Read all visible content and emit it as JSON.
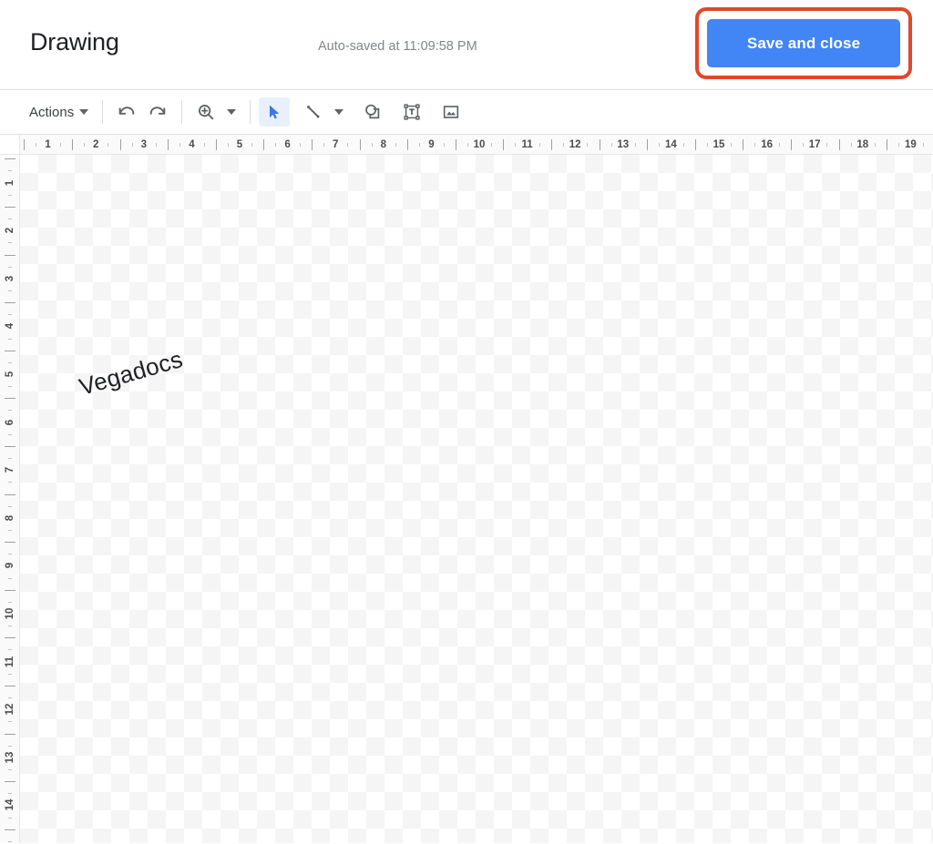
{
  "header": {
    "title": "Drawing",
    "autosave_status": "Auto-saved at 11:09:58 PM",
    "save_button_label": "Save and close",
    "accent_color": "#4285f4",
    "annotation_color": "#e0472c"
  },
  "toolbar": {
    "actions_label": "Actions",
    "items": [
      {
        "name": "actions-menu",
        "label": "Actions",
        "icon": "caret-down-icon"
      },
      {
        "name": "undo-button",
        "label": "Undo",
        "icon": "undo-icon"
      },
      {
        "name": "redo-button",
        "label": "Redo",
        "icon": "redo-icon"
      },
      {
        "name": "zoom-tool",
        "label": "Zoom",
        "icon": "zoom-in-icon"
      },
      {
        "name": "select-tool",
        "label": "Select",
        "icon": "cursor-arrow-icon",
        "active": true
      },
      {
        "name": "line-tool",
        "label": "Line",
        "icon": "line-icon"
      },
      {
        "name": "shape-tool",
        "label": "Shape",
        "icon": "shape-icon"
      },
      {
        "name": "text-box-tool",
        "label": "Text box",
        "icon": "text-box-icon"
      },
      {
        "name": "image-tool",
        "label": "Image",
        "icon": "image-icon"
      }
    ],
    "active_tool": "select-tool",
    "active_color": "#1a73e8",
    "active_background": "#e8f0fe"
  },
  "rulers": {
    "horizontal_numbers": [
      1,
      2,
      3,
      4,
      5,
      6,
      7,
      8,
      9,
      10,
      11,
      12,
      13,
      14,
      15,
      16,
      17,
      18,
      19
    ],
    "vertical_numbers": [
      1,
      2,
      3,
      4,
      5,
      6,
      7,
      8,
      9,
      10,
      11,
      12,
      13,
      14
    ],
    "unit_spacing_px": 52.6,
    "unit": "inch"
  },
  "canvas": {
    "text_object": "Vegadocs",
    "text_rotation_degrees": -16,
    "background": "transparent-checkerboard",
    "checker_light": "#ffffff",
    "checker_dark": "#f5f5f5"
  }
}
